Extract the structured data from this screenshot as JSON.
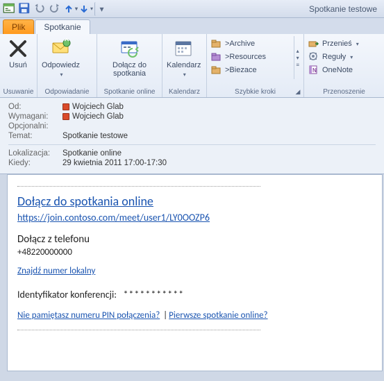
{
  "window": {
    "title": "Spotkanie testowe"
  },
  "tabs": {
    "file": "Plik",
    "meeting": "Spotkanie"
  },
  "ribbon": {
    "delete_group": {
      "label": "Usuwanie",
      "delete": "Usuń"
    },
    "respond_group": {
      "label": "Odpowiadanie",
      "respond": "Odpowiedz"
    },
    "online_group": {
      "label": "Spotkanie online",
      "join": "Dołącz do spotkania"
    },
    "calendar_group": {
      "label": "Kalendarz",
      "calendar": "Kalendarz"
    },
    "quicksteps_group": {
      "label": "Szybkie kroki",
      "items": [
        ">Archive",
        ">Resources",
        ">Biezace"
      ]
    },
    "move_group": {
      "label": "Przenoszenie",
      "move": "Przenieś",
      "rules": "Reguły",
      "onenote": "OneNote"
    }
  },
  "headers": {
    "from_label": "Od:",
    "from_value": "Wojciech Glab",
    "required_label": "Wymagani:",
    "required_value": "Wojciech Glab",
    "optional_label": "Opcjonalni:",
    "subject_label": "Temat:",
    "subject_value": "Spotkanie testowe",
    "location_label": "Lokalizacja:",
    "location_value": "Spotkanie online",
    "when_label": "Kiedy:",
    "when_value": "29 kwietnia 2011 17:00-17:30"
  },
  "body": {
    "join_title": "Dołącz do spotkania online",
    "join_url": "https://join.contoso.com/meet/user1/LY0OOZP6",
    "phone_title": "Dołącz z telefonu",
    "phone_number": "+48220000000",
    "find_local": "Znajdź numer lokalny",
    "conf_id_label": "Identyfikator konferencji:",
    "conf_id_mask": "***********",
    "forgot_pin": "Nie pamiętasz numeru PIN połączenia?",
    "first_meeting": "Pierwsze spotkanie online?"
  }
}
